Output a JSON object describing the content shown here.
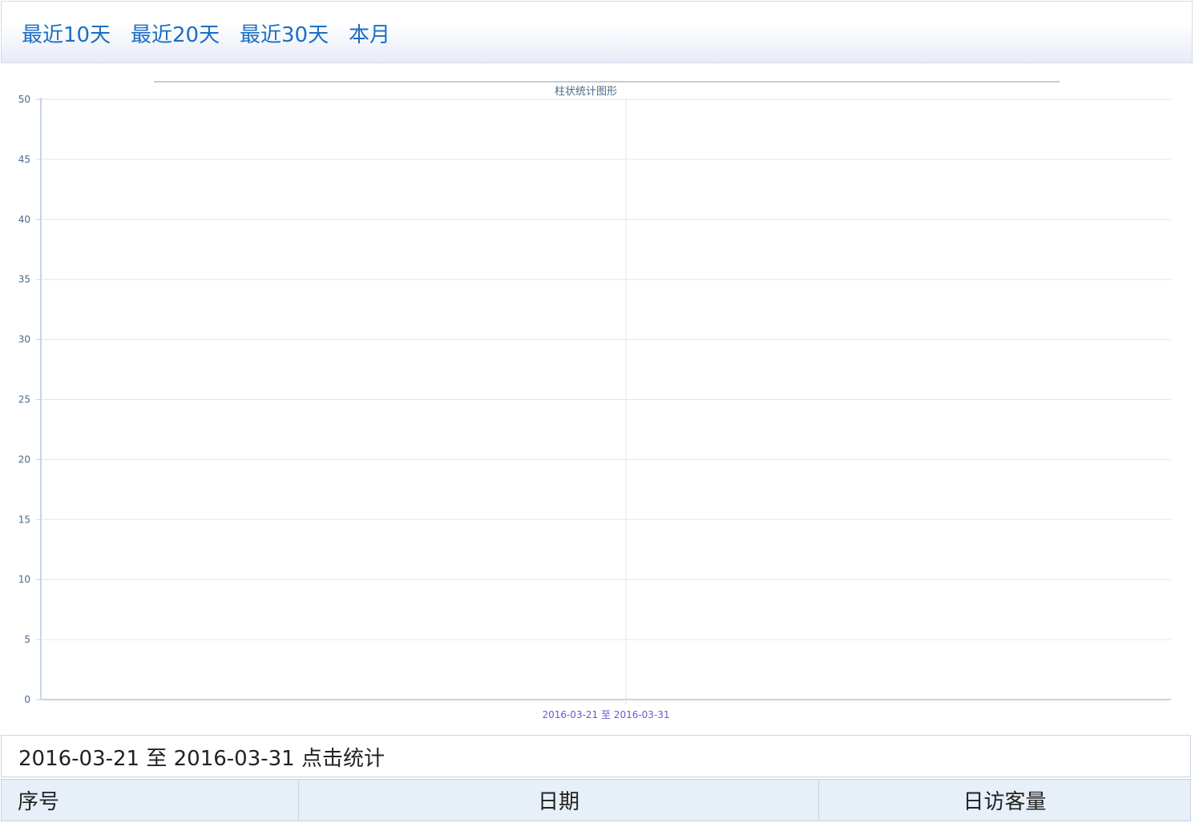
{
  "topbar": {
    "ranges": [
      {
        "label": "最近10天"
      },
      {
        "label": "最近20天"
      },
      {
        "label": "最近30天"
      },
      {
        "label": "本月"
      }
    ],
    "link_color": "#1a6fc4"
  },
  "chart_data": {
    "type": "bar",
    "title": "柱状统计图形",
    "categories": [
      "2016-03-21 至 2016-03-31"
    ],
    "series": [
      {
        "values": [
          0
        ]
      }
    ],
    "ylim": [
      0,
      50
    ],
    "yticks": [
      0,
      5,
      10,
      15,
      20,
      25,
      30,
      35,
      40,
      45,
      50
    ],
    "grid": true,
    "xlabel": "",
    "ylabel": "",
    "colors": {
      "title": "#4a6a8a",
      "tick": "#4a6a8a",
      "category": "#6a5acd",
      "grid": "#e6e6e6",
      "axis": "#c8d6e5"
    }
  },
  "stats": {
    "caption": "2016-03-21 至 2016-03-31 点击统计",
    "headers": {
      "index": "序号",
      "date": "日期",
      "visits": "日访客量"
    }
  }
}
